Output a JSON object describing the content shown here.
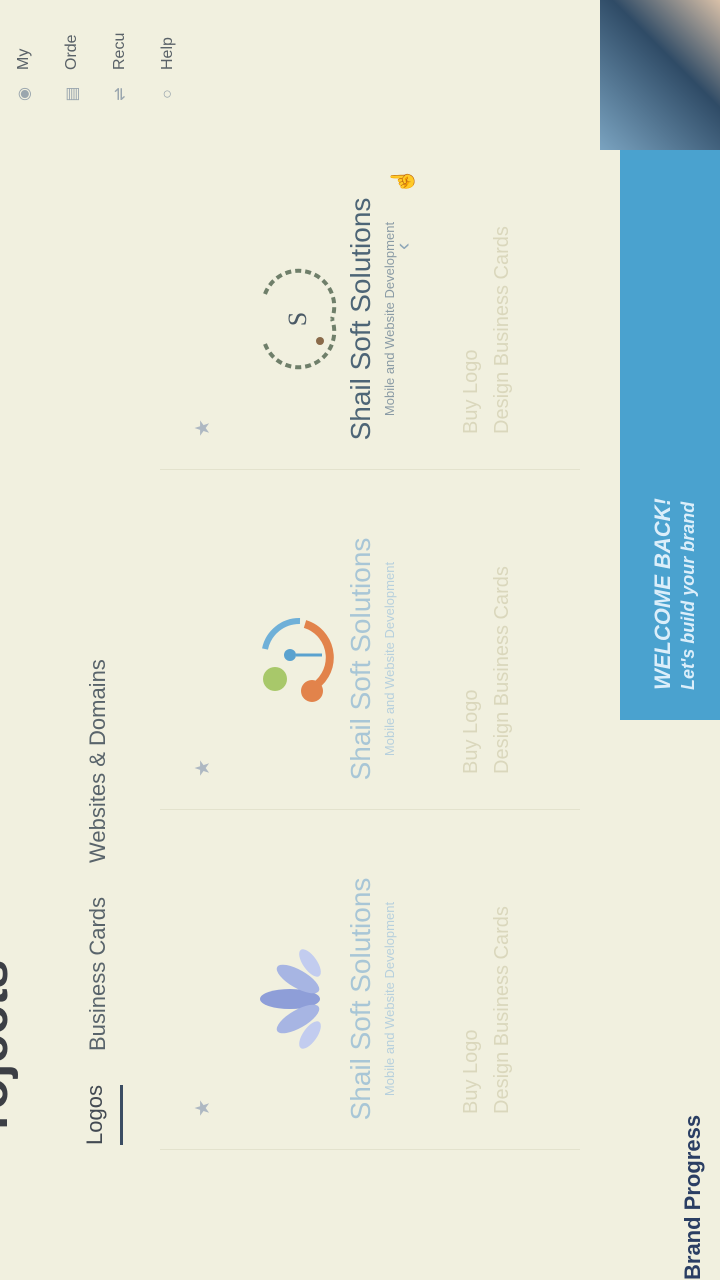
{
  "page": {
    "heading": "rojects"
  },
  "tabs": [
    {
      "label": "Logos",
      "active": true
    },
    {
      "label": "Business Cards",
      "active": false
    },
    {
      "label": "Websites & Domains",
      "active": false
    }
  ],
  "cards": [
    {
      "brand": "Shail Soft Solutions",
      "tagline": "Mobile and Website Development",
      "links": [
        "Buy Logo",
        "Design Business Cards"
      ],
      "logo": "lotus-logo"
    },
    {
      "brand": "Shail Soft Solutions",
      "tagline": "Mobile and Website Development",
      "links": [
        "Buy Logo",
        "Design Business Cards"
      ],
      "logo": "circle-people-logo"
    },
    {
      "brand": "Shail Soft Solutions",
      "tagline": "Mobile and Website Development",
      "links": [
        "Buy Logo",
        "Design Business Cards"
      ],
      "logo": "laurel-s-logo"
    }
  ],
  "sidebar": {
    "items": [
      {
        "label": "My",
        "icon": "user-icon"
      },
      {
        "label": "Orde",
        "icon": "orders-icon"
      },
      {
        "label": "Recu",
        "icon": "recurring-icon"
      },
      {
        "label": "Help",
        "icon": "help-icon"
      }
    ]
  },
  "footer": {
    "brand_progress": "Brand Progress",
    "welcome_title": "WELCOME BACK!",
    "welcome_sub": "Let's build your brand"
  },
  "colors": {
    "accent": "#4aa2cf",
    "brand_dark": "#2a3e63",
    "background": "#f1f0df"
  }
}
